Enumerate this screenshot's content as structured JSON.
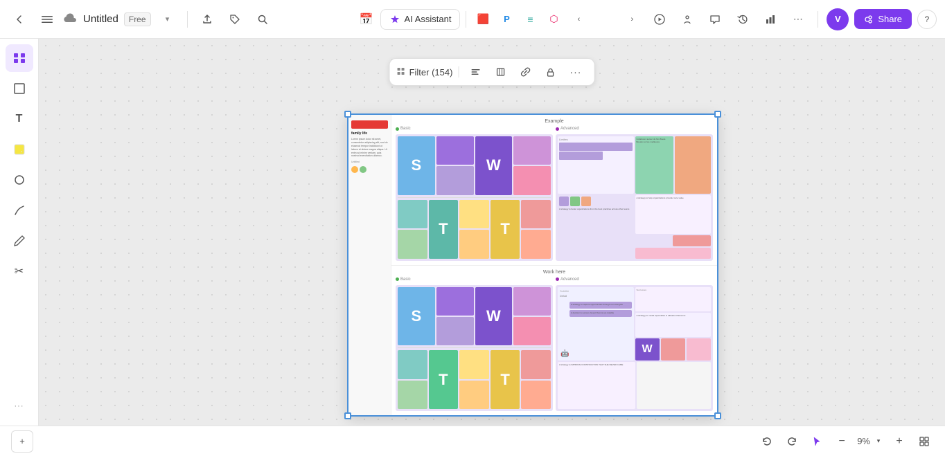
{
  "header": {
    "back_label": "‹",
    "menu_label": "☰",
    "cloud_icon": "☁",
    "title": "Untitled",
    "badge_free": "Free",
    "chevron": "▾",
    "export_icon": "⬆",
    "tag_icon": "🏷",
    "search_icon": "🔍",
    "ai_assistant_label": "AI Assistant",
    "toolbar_icons": [
      "🗓",
      "P",
      "≡",
      "⬡"
    ],
    "more_icon": "‹",
    "expand_icon": "›",
    "play_icon": "▶",
    "present_icon": "⬡",
    "chat_icon": "💬",
    "history_icon": "⟳",
    "chart_icon": "📊",
    "more2_icon": "⋯",
    "avatar_label": "V",
    "share_icon": "👤",
    "share_label": "Share",
    "help_icon": "?"
  },
  "floating_toolbar": {
    "filter_label": "Filter (154)",
    "align_icon": "≡",
    "frame_icon": "⬜",
    "link_icon": "⚙",
    "lock_icon": "🔒",
    "more_icon": "···"
  },
  "sidebar": {
    "items": [
      {
        "name": "frames",
        "icon": "⊞",
        "active": true
      },
      {
        "name": "frame-tool",
        "icon": "⬜"
      },
      {
        "name": "text-tool",
        "icon": "T"
      },
      {
        "name": "sticky-note",
        "icon": "🗒"
      },
      {
        "name": "shapes",
        "icon": "○"
      },
      {
        "name": "pen",
        "icon": "〜"
      },
      {
        "name": "pencil",
        "icon": "✏"
      },
      {
        "name": "scissors",
        "icon": "✂"
      }
    ],
    "more_label": "···"
  },
  "canvas": {
    "frame_title_example": "Example",
    "frame_title_work": "Work here",
    "section_basic_label": "Basic",
    "section_advanced_label": "Advanced",
    "dot_basic_color": "#4caf50",
    "dot_advanced_color": "#9c27b0",
    "sticky_letters": [
      "S",
      "W",
      "T"
    ],
    "sticky_colors": {
      "blue": "#6eb5e8",
      "purple": "#9c6fdd",
      "dark_purple": "#7c52cc",
      "teal": "#5db8a8",
      "yellow": "#e8c44a",
      "green": "#55c890",
      "orange": "#f0a880"
    }
  },
  "bottom_bar": {
    "undo_icon": "↩",
    "redo_icon": "↪",
    "cursor_icon": "↖",
    "zoom_out_icon": "−",
    "zoom_level": "9%",
    "zoom_chevron": "▾",
    "zoom_in_icon": "+",
    "grid_icon": "⊞",
    "add_page_icon": "+"
  }
}
